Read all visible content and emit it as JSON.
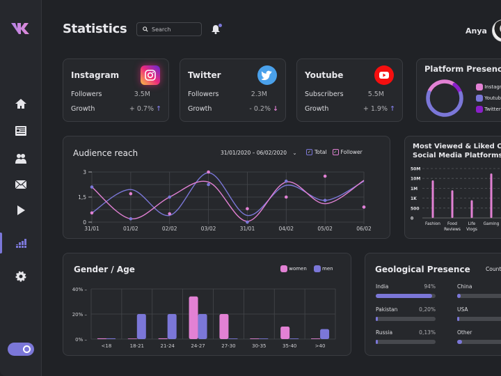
{
  "app": {
    "logo": "vk-logo"
  },
  "header": {
    "title": "Statistics",
    "search_placeholder": "Search",
    "username": "Anya",
    "notification_dot": true
  },
  "sidebar": {
    "items": [
      {
        "name": "home",
        "icon": "home-icon"
      },
      {
        "name": "news",
        "icon": "newspaper-icon"
      },
      {
        "name": "friends",
        "icon": "users-icon"
      },
      {
        "name": "messages",
        "icon": "mail-icon"
      },
      {
        "name": "videos",
        "icon": "play-icon"
      },
      {
        "name": "statistics",
        "icon": "bar-chart-icon",
        "active": true
      },
      {
        "name": "settings",
        "icon": "gear-icon"
      }
    ],
    "theme_toggle_on": true
  },
  "stats": [
    {
      "platform": "Instagram",
      "metric1_label": "Followers",
      "metric1_value": "3.5M",
      "growth_label": "Growth",
      "growth_value": "+ 0.7%",
      "growth_dir": "up"
    },
    {
      "platform": "Twitter",
      "metric1_label": "Followers",
      "metric1_value": "2.3M",
      "growth_label": "Growth",
      "growth_value": "- 0.2%",
      "growth_dir": "down"
    },
    {
      "platform": "Youtube",
      "metric1_label": "Subscribers",
      "metric1_value": "5.5M",
      "growth_label": "Growth",
      "growth_value": "+ 1.9%",
      "growth_dir": "up"
    }
  ],
  "platform_presence": {
    "title": "Platform Presence",
    "legend": [
      {
        "label": "Instagram",
        "color": "#e281d4"
      },
      {
        "label": "Youtube",
        "color": "#7b77d8"
      },
      {
        "label": "Twitter",
        "color": "#8a1fc9"
      }
    ]
  },
  "colors": {
    "accent": "#7b77d8",
    "pink": "#e281d4",
    "purple": "#8a1fc9"
  },
  "audience": {
    "title": "Audience reach",
    "date_range": "31/01/2020 – 06/02/2020",
    "legend_total": "Total",
    "legend_follower": "Follower"
  },
  "most_viewed": {
    "title_line1": "Most Viewed & Liked Content on",
    "title_line2": "Social Media Platforms"
  },
  "gender_age": {
    "title": "Gender / Age",
    "legend_women": "women",
    "legend_men": "men"
  },
  "geo": {
    "title": "Geological Presence",
    "filter_label": "Country",
    "items": [
      {
        "country": "India",
        "pct": "94%",
        "fill": 0.94
      },
      {
        "country": "Pakistan",
        "pct": "0,20%",
        "fill": 0.02
      },
      {
        "country": "Russia",
        "pct": "0,13%",
        "fill": 0.015
      },
      {
        "country": "China",
        "pct": "",
        "fill": 0.06
      },
      {
        "country": "USA",
        "pct": "",
        "fill": 0.02
      },
      {
        "country": "Other",
        "pct": "",
        "fill": 0.08
      }
    ]
  },
  "chart_data": [
    {
      "id": "audience",
      "type": "line",
      "title": "Audience reach",
      "x": [
        "31/01",
        "01/02",
        "02/02",
        "03/02",
        "31/01",
        "04/02",
        "05/02",
        "06/02"
      ],
      "ylim": [
        0,
        3
      ],
      "yticks": [
        "0",
        "1,5",
        "3"
      ],
      "grid": true,
      "series": [
        {
          "name": "Total",
          "color": "#7b77d8",
          "values": [
            0.55,
            1.95,
            0.4,
            2.95,
            0.4,
            2.2,
            1.3,
            2.45
          ]
        },
        {
          "name": "Follower",
          "color": "#e281d4",
          "values": [
            2.1,
            0.2,
            1.5,
            2.4,
            0.05,
            2.4,
            1.1,
            2.5
          ]
        }
      ],
      "markers": [
        {
          "series": "Total",
          "values": [
            2.1,
            0.2,
            1.5,
            2.25,
            0.0,
            2.45,
            1.3,
            0.9
          ]
        },
        {
          "series": "Follower",
          "values": [
            0.55,
            1.7,
            0.5,
            3.0,
            0.8,
            1.5,
            2.75,
            0.9
          ]
        }
      ]
    },
    {
      "id": "most_viewed",
      "type": "bar",
      "title": "Most Viewed & Liked Content on Social Media Platforms",
      "categories": [
        "Fashion",
        "Food Reviews",
        "Life Vlogs",
        "Gaming"
      ],
      "yticks": [
        "0",
        "500",
        "1K",
        "1M",
        "10M",
        "50M"
      ],
      "values_tick_index": [
        3.8,
        2.8,
        1.8,
        4.5
      ],
      "color": "#e281d4"
    },
    {
      "id": "gender_age",
      "type": "bar",
      "title": "Gender / Age",
      "categories": [
        "<18",
        "18-21",
        "21-24",
        "24-27",
        "27-30",
        "30-35",
        "35-40",
        ">40"
      ],
      "ylim": [
        0,
        40
      ],
      "yticks": [
        "0%",
        "20%",
        "40%"
      ],
      "series": [
        {
          "name": "women",
          "color": "#e281d4",
          "values": [
            0.6,
            0.3,
            0.6,
            34,
            20,
            0.5,
            10,
            0.5
          ]
        },
        {
          "name": "men",
          "color": "#7b77d8",
          "values": [
            0.6,
            20,
            20,
            20,
            0.5,
            0.5,
            0.5,
            8
          ]
        }
      ]
    },
    {
      "id": "platform_presence",
      "type": "pie",
      "title": "Platform Presence",
      "labels": [
        "Instagram",
        "Youtube",
        "Twitter"
      ],
      "values": [
        28,
        62,
        10
      ]
    }
  ]
}
